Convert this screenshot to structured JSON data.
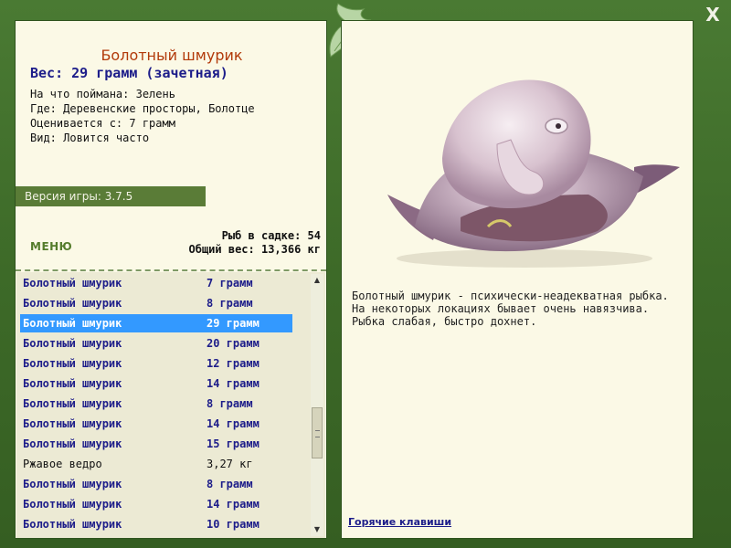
{
  "window": {
    "close_label": "X"
  },
  "fish_card": {
    "name": "Болотный шмурик",
    "weight": "Вес: 29 грамм (зачетная)",
    "info": [
      "На что поймана: Зелень",
      "Где: Деревенские просторы, Болотце",
      "Оценивается с: 7 грамм",
      "Вид: Ловится часто"
    ]
  },
  "version": "Версия игры: 3.7.5",
  "menu_label": "МЕНЮ",
  "stats": {
    "count": "Рыб в садке: 54",
    "total": "Общий вес: 13,366 кг"
  },
  "catch_list": [
    {
      "name": "Болотный шмурик",
      "weight": "7 грамм",
      "style": "fish"
    },
    {
      "name": "Болотный шмурик",
      "weight": "8 грамм",
      "style": "fish"
    },
    {
      "name": "Болотный шмурик",
      "weight": "29 грамм",
      "style": "selected"
    },
    {
      "name": "Болотный шмурик",
      "weight": "20 грамм",
      "style": "fish"
    },
    {
      "name": "Болотный шмурик",
      "weight": "12 грамм",
      "style": "fish"
    },
    {
      "name": "Болотный шмурик",
      "weight": "14 грамм",
      "style": "fish"
    },
    {
      "name": "Болотный шмурик",
      "weight": "8 грамм",
      "style": "fish"
    },
    {
      "name": "Болотный шмурик",
      "weight": "14 грамм",
      "style": "fish"
    },
    {
      "name": "Болотный шмурик",
      "weight": "15 грамм",
      "style": "fish"
    },
    {
      "name": "Ржавое ведро",
      "weight": "3,27 кг",
      "style": "plain"
    },
    {
      "name": "Болотный шмурик",
      "weight": "8 грамм",
      "style": "fish"
    },
    {
      "name": "Болотный шмурик",
      "weight": "14 грамм",
      "style": "fish"
    },
    {
      "name": "Болотный шмурик",
      "weight": "10 грамм",
      "style": "fish"
    }
  ],
  "description": [
    "Болотный шмурик - психически-неадекватная рыбка.",
    "На некоторых локациях бывает очень навязчива.",
    "Рыбка слабая, быстро дохнет."
  ],
  "hotkeys_label": "Горячие клавиши",
  "icons": {
    "close": "close-icon",
    "logo": "leaf-fish-logo-icon",
    "scroll_up": "arrow-up-icon",
    "scroll_down": "arrow-down-icon"
  },
  "colors": {
    "frame_green": "#3f6a2a",
    "panel_bg": "#fbf9e6",
    "name_orange": "#b23a0a",
    "fish_text_blue": "#1d1d8a",
    "selection_blue": "#3399ff"
  }
}
